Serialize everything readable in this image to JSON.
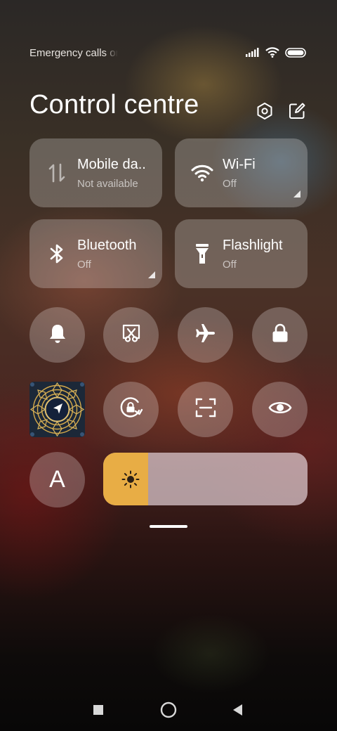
{
  "status_bar": {
    "carrier_text": "Emergency calls only",
    "icons": [
      "signal-icon",
      "wifi-icon",
      "battery-icon"
    ]
  },
  "header": {
    "title": "Control centre",
    "buttons": [
      "settings-icon",
      "edit-icon"
    ]
  },
  "tiles": [
    {
      "name": "Mobile da..",
      "state": "Not available",
      "icon": "mobile-data-icon"
    },
    {
      "name": "Wi-Fi",
      "state": "Off",
      "icon": "wifi-icon",
      "has_corner": true
    },
    {
      "name": "Bluetooth",
      "state": "Off",
      "icon": "bluetooth-icon",
      "has_corner": true
    },
    {
      "name": "Flashlight",
      "state": "Off",
      "icon": "flashlight-icon"
    }
  ],
  "toggles": {
    "row1": [
      "bell-icon",
      "screen-cast-icon",
      "airplane-icon",
      "lock-icon"
    ],
    "row2": [
      "navigation-app-icon",
      "rotation-lock-icon",
      "scan-icon",
      "eye-icon"
    ],
    "row3_label": "A"
  },
  "brightness": {
    "level": 0.22,
    "icon": "sun-icon"
  },
  "colors": {
    "brightness_fill": "#e8ad45",
    "tile_bg": "rgba(255,255,255,0.24)"
  },
  "navbar": [
    "recents-square-icon",
    "home-circle-icon",
    "back-triangle-icon"
  ]
}
